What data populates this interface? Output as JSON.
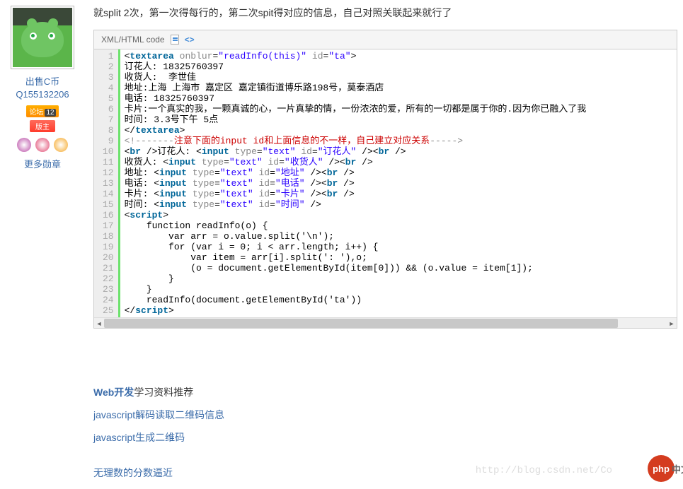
{
  "sidebar": {
    "username": "出售C币Q155132206",
    "badge_forum": "论坛",
    "badge_forum_n": "12",
    "badge_owner": "版主",
    "more_medals": "更多勋章"
  },
  "main": {
    "intro": "就split 2次，第一次得每行的，第二次spit得对应的信息，自己对照关联起来就行了"
  },
  "code": {
    "header": "XML/HTML code",
    "lines": [
      {
        "n": "1",
        "html": "&lt;<span class='t-tag'>textarea</span> <span class='t-attr'>onblur</span>=<span class='t-str'>\"readInfo(this)\"</span> <span class='t-attr'>id</span>=<span class='t-str'>\"ta\"</span>&gt;"
      },
      {
        "n": "2",
        "html": "订花人: 18325760397"
      },
      {
        "n": "3",
        "html": "收货人:  李世佳"
      },
      {
        "n": "4",
        "html": "地址:上海 上海市 嘉定区 嘉定镇街道博乐路198号，莫泰酒店"
      },
      {
        "n": "5",
        "html": "电话: 18325760397"
      },
      {
        "n": "6",
        "html": "卡片:一个真实的我，一颗真诚的心，一片真挚的情，一份浓浓的爱，所有的一切都是属于你的.因为你已融入了我"
      },
      {
        "n": "7",
        "html": "时间: 3.3号下午 5点"
      },
      {
        "n": "8",
        "html": "&lt;/<span class='t-tag'>textarea</span>&gt;"
      },
      {
        "n": "9",
        "html": "<span class='t-cmt'>&lt;!-------</span><span class='t-red'>注意下面的input id和上面信息的不一样，自己建立对应关系</span><span class='t-cmt'>-----&gt;</span>"
      },
      {
        "n": "10",
        "html": "&lt;<span class='t-tag'>br</span> /&gt;订花人: &lt;<span class='t-tag'>input</span> <span class='t-attr'>type</span>=<span class='t-str'>\"text\"</span> <span class='t-attr'>id</span>=<span class='t-str'>\"订花人\"</span> /&gt;&lt;<span class='t-tag'>br</span> /&gt;"
      },
      {
        "n": "11",
        "html": "收货人: &lt;<span class='t-tag'>input</span> <span class='t-attr'>type</span>=<span class='t-str'>\"text\"</span> <span class='t-attr'>id</span>=<span class='t-str'>\"收货人\"</span> /&gt;&lt;<span class='t-tag'>br</span> /&gt;"
      },
      {
        "n": "12",
        "html": "地址: &lt;<span class='t-tag'>input</span> <span class='t-attr'>type</span>=<span class='t-str'>\"text\"</span> <span class='t-attr'>id</span>=<span class='t-str'>\"地址\"</span> /&gt;&lt;<span class='t-tag'>br</span> /&gt;"
      },
      {
        "n": "13",
        "html": "电话: &lt;<span class='t-tag'>input</span> <span class='t-attr'>type</span>=<span class='t-str'>\"text\"</span> <span class='t-attr'>id</span>=<span class='t-str'>\"电话\"</span> /&gt;&lt;<span class='t-tag'>br</span> /&gt;"
      },
      {
        "n": "14",
        "html": "卡片: &lt;<span class='t-tag'>input</span> <span class='t-attr'>type</span>=<span class='t-str'>\"text\"</span> <span class='t-attr'>id</span>=<span class='t-str'>\"卡片\"</span> /&gt;&lt;<span class='t-tag'>br</span> /&gt;"
      },
      {
        "n": "15",
        "html": "时间: &lt;<span class='t-tag'>input</span> <span class='t-attr'>type</span>=<span class='t-str'>\"text\"</span> <span class='t-attr'>id</span>=<span class='t-str'>\"时间\"</span> /&gt;"
      },
      {
        "n": "16",
        "html": "&lt;<span class='t-tag'>script</span>&gt;"
      },
      {
        "n": "17",
        "html": "    function readInfo(o) {"
      },
      {
        "n": "18",
        "html": "        var arr = o.value.split('\\n');"
      },
      {
        "n": "19",
        "html": "        for (var i = 0; i &lt; arr.length; i++) {"
      },
      {
        "n": "20",
        "html": "            var item = arr[i].split(': '),o;"
      },
      {
        "n": "21",
        "html": "            (o = document.getElementById(item[0])) &amp;&amp; (o.value = item[1]);"
      },
      {
        "n": "22",
        "html": "        }"
      },
      {
        "n": "23",
        "html": "    }"
      },
      {
        "n": "24",
        "html": "    readInfo(document.getElementById('ta'))"
      },
      {
        "n": "25",
        "html": "&lt;/<span class='t-tag'>script</span>&gt;"
      }
    ]
  },
  "recommend": {
    "title_link": "Web开发",
    "title_suffix": "学习资料推荐",
    "link1": "javascript解码读取二维码信息",
    "link2": "javascript生成二维码"
  },
  "footer": {
    "link1": "无理数的分数逼近"
  },
  "watermark": "http://blog.csdn.net/Co",
  "logo": {
    "circle": "php",
    "text": "中文网"
  }
}
